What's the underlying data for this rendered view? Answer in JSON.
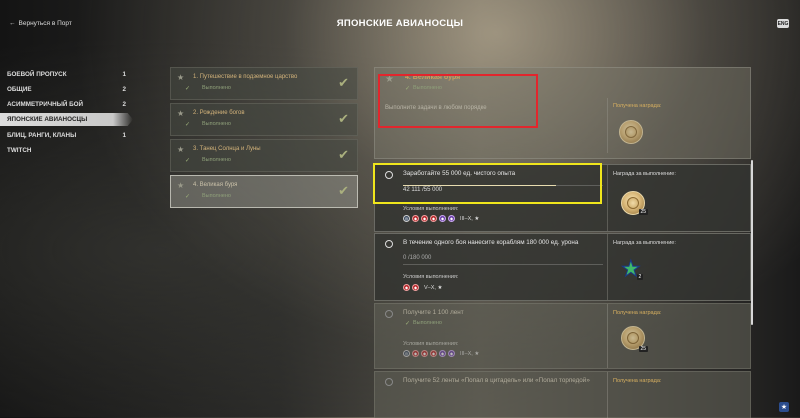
{
  "header": {
    "back_label": "Вернуться в Порт",
    "back_icon": "arrow-left-icon",
    "title": "ЯПОНСКИЕ АВИАНОСЦЫ",
    "corner_badge": "ENG"
  },
  "sidebar": {
    "items": [
      {
        "label": "БОЕВОЙ ПРОПУСК",
        "count": "1"
      },
      {
        "label": "ОБЩИЕ",
        "count": "2"
      },
      {
        "label": "АСИММЕТРИЧНЫЙ БОЙ",
        "count": "2"
      },
      {
        "label": "ЯПОНСКИЕ АВИАНОСЦЫ",
        "count": ""
      },
      {
        "label": "БЛИЦ, РАНГИ, КЛАНЫ",
        "count": "1"
      },
      {
        "label": "TWITCH",
        "count": ""
      }
    ]
  },
  "missions": [
    {
      "name": "1. Путешествие в подземное царство",
      "status": "Выполнено"
    },
    {
      "name": "2. Рождение богов",
      "status": "Выполнено"
    },
    {
      "name": "3. Танец Солнца и Луны",
      "status": "Выполнено"
    },
    {
      "name": "4. Великая буря",
      "status": "Выполнено"
    }
  ],
  "detail": {
    "name": "4. Великая буря",
    "status": "Выполнено",
    "description": "Выполните задачи в любом порядке",
    "reward_label": "Получена награда:"
  },
  "tasks": [
    {
      "name": "Заработайте 55 000 ед. чистого опыта",
      "progress_text": "42 111 /55 000",
      "progress": 0.7656,
      "conditions_label": "Условия выполнения:",
      "tier": "III–X, ★",
      "reward_label": "Награда за выполнение:",
      "reward_qty": "25"
    },
    {
      "name": "В течение одного боя нанесите кораблям 180 000 ед. урона",
      "progress_text": "0 /180 000",
      "progress": 0,
      "conditions_label": "Условия выполнения:",
      "tier": "V–X, ★",
      "reward_label": "Награда за выполнение:",
      "reward_qty": "2"
    },
    {
      "name": "Получите 1 100 лент",
      "status": "Выполнено",
      "conditions_label": "Условия выполнения:",
      "tier": "III–X, ★",
      "reward_label": "Получена награда:",
      "reward_qty": "25"
    },
    {
      "name": "Получите 52 ленты «Попал в цитадель» или «Попал торпедой»",
      "reward_label": "Получена награда:"
    }
  ],
  "colors": {
    "highlight_red": "#e2262d",
    "highlight_yellow": "#f0e61c",
    "gold": "#d8b060"
  }
}
